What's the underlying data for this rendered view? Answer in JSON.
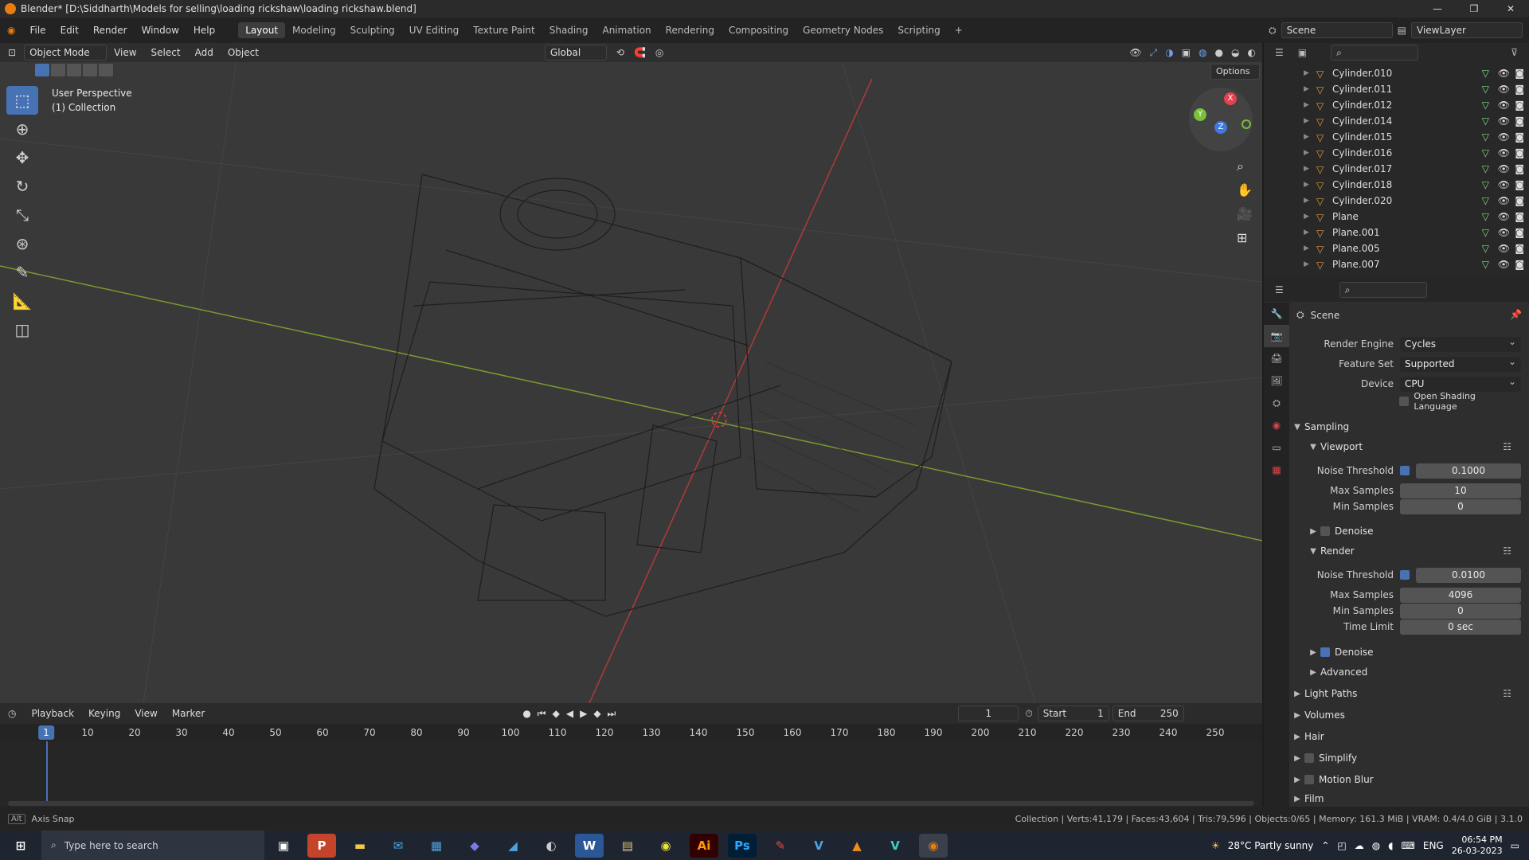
{
  "window": {
    "title": "Blender* [D:\\Siddharth\\Models for selling\\loading rickshaw\\loading rickshaw.blend]"
  },
  "menu": [
    "File",
    "Edit",
    "Render",
    "Window",
    "Help"
  ],
  "workspaces": [
    "Layout",
    "Modeling",
    "Sculpting",
    "UV Editing",
    "Texture Paint",
    "Shading",
    "Animation",
    "Rendering",
    "Compositing",
    "Geometry Nodes",
    "Scripting"
  ],
  "scene_field": "Scene",
  "viewlayer_field": "ViewLayer",
  "viewport_header": {
    "mode": "Object Mode",
    "items": [
      "View",
      "Select",
      "Add",
      "Object"
    ],
    "orientation": "Global",
    "options": "Options"
  },
  "viewport_info": {
    "perspective": "User Perspective",
    "collection": "(1) Collection"
  },
  "gizmo": {
    "x": "X",
    "y": "Y",
    "z": "Z"
  },
  "outliner": {
    "items": [
      "Cylinder.010",
      "Cylinder.011",
      "Cylinder.012",
      "Cylinder.014",
      "Cylinder.015",
      "Cylinder.016",
      "Cylinder.017",
      "Cylinder.018",
      "Cylinder.020",
      "Plane",
      "Plane.001",
      "Plane.005",
      "Plane.007"
    ]
  },
  "properties": {
    "scene_label": "Scene",
    "render_engine_label": "Render Engine",
    "render_engine": "Cycles",
    "feature_set_label": "Feature Set",
    "feature_set": "Supported",
    "device_label": "Device",
    "device": "CPU",
    "osl_label": "Open Shading Language",
    "sampling": "Sampling",
    "viewport": "Viewport",
    "vp_noise_label": "Noise Threshold",
    "vp_noise": "0.1000",
    "vp_max_label": "Max Samples",
    "vp_max": "10",
    "vp_min_label": "Min Samples",
    "vp_min": "0",
    "vp_denoise": "Denoise",
    "render": "Render",
    "r_noise_label": "Noise Threshold",
    "r_noise": "0.0100",
    "r_max_label": "Max Samples",
    "r_max": "4096",
    "r_min_label": "Min Samples",
    "r_min": "0",
    "r_time_label": "Time Limit",
    "r_time": "0 sec",
    "r_denoise": "Denoise",
    "advanced": "Advanced",
    "light_paths": "Light Paths",
    "volumes": "Volumes",
    "hair": "Hair",
    "simplify": "Simplify",
    "motion_blur": "Motion Blur",
    "film": "Film"
  },
  "timeline": {
    "menus": [
      "Playback",
      "Keying",
      "View",
      "Marker"
    ],
    "current_frame": "1",
    "start_label": "Start",
    "start": "1",
    "end_label": "End",
    "end": "250",
    "ticks": [
      "1",
      "10",
      "20",
      "30",
      "40",
      "50",
      "60",
      "70",
      "80",
      "90",
      "100",
      "110",
      "120",
      "130",
      "140",
      "150",
      "160",
      "170",
      "180",
      "190",
      "200",
      "210",
      "220",
      "230",
      "240",
      "250"
    ]
  },
  "statusbar": {
    "left": "Axis Snap",
    "right": "Collection | Verts:41,179 | Faces:43,604 | Tris:79,596 | Objects:0/65 | Memory: 161.3 MiB | VRAM: 0.4/4.0 GiB | 3.1.0"
  },
  "taskbar": {
    "search_placeholder": "Type here to search",
    "weather": "28°C  Partly sunny",
    "lang": "ENG",
    "time": "06:54 PM",
    "date": "26-03-2023"
  }
}
